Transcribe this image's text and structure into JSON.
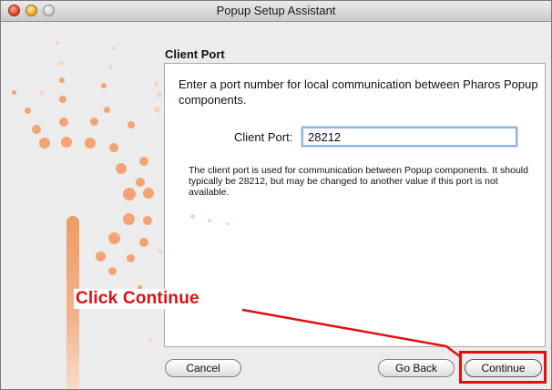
{
  "window": {
    "title": "Popup Setup Assistant"
  },
  "section": {
    "title": "Client Port"
  },
  "content": {
    "intro": "Enter a port number for local communication between Pharos Popup components.",
    "port_label": "Client Port:",
    "port_value": "28212",
    "note": "The client port is used for communication between Popup components. It should typically be 28212, but may be changed to another value if this port is not available."
  },
  "buttons": {
    "cancel": "Cancel",
    "go_back": "Go Back",
    "continue": "Continue"
  },
  "annotation": {
    "callout": "Click Continue",
    "color": "#e01010"
  },
  "colors": {
    "accent_dots": "#f4a474",
    "input_focus": "#8db2e3"
  }
}
